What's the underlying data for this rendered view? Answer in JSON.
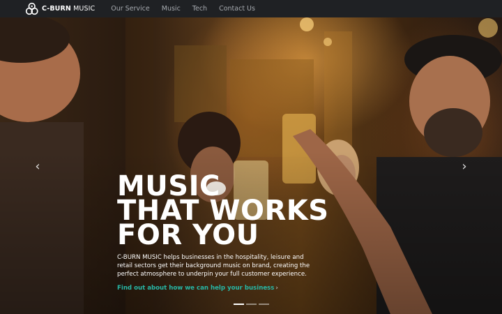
{
  "navbar": {
    "brand_bold": "C-BURN",
    "brand_rest": " MUSIC",
    "links": [
      "Our Service",
      "Music",
      "Tech",
      "Contact Us"
    ]
  },
  "hero": {
    "headline_lines": [
      "MUSIC",
      "THAT WORKS",
      "FOR YOU"
    ],
    "description": "C-BURN MUSIC helps businesses in the hospitality, leisure and retail sectors get their background music on brand, creating the perfect atmosphere to underpin your full customer experience.",
    "cta_label": "Find out about how we can help your business",
    "cta_chevron": "›",
    "prev_arrow": "‹",
    "next_arrow": "›",
    "slide_count": 3,
    "active_slide": 1
  },
  "icons": {
    "logo": "c-burn-logo-icon",
    "prev": "chevron-left-icon",
    "next": "chevron-right-icon"
  },
  "colors": {
    "navbar_bg": "#1f2124",
    "nav_link": "#a7abb0",
    "cta": "#27b7a6",
    "headline": "#ffffff"
  }
}
